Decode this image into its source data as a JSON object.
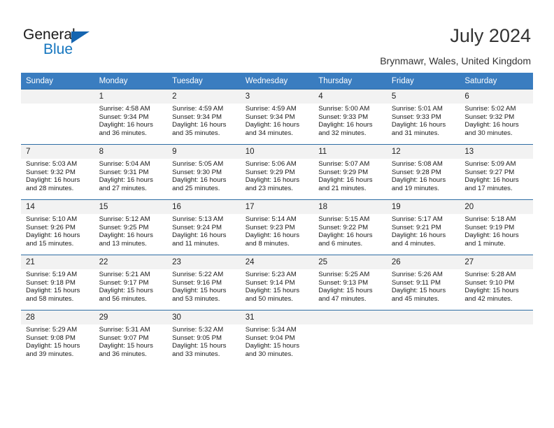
{
  "brand": {
    "name_top": "General",
    "name_bottom": "Blue",
    "accent_color": "#1576bf",
    "triangle_color": "#1565b0"
  },
  "header": {
    "title": "July 2024",
    "subtitle": "Brynmawr, Wales, United Kingdom"
  },
  "calendar": {
    "header_color": "#3a7dc0",
    "weekdays": [
      "Sunday",
      "Monday",
      "Tuesday",
      "Wednesday",
      "Thursday",
      "Friday",
      "Saturday"
    ],
    "weeks": [
      [
        {
          "day": "",
          "empty": true
        },
        {
          "day": "1",
          "sunrise": "Sunrise: 4:58 AM",
          "sunset": "Sunset: 9:34 PM",
          "daylight": "Daylight: 16 hours and 36 minutes."
        },
        {
          "day": "2",
          "sunrise": "Sunrise: 4:59 AM",
          "sunset": "Sunset: 9:34 PM",
          "daylight": "Daylight: 16 hours and 35 minutes."
        },
        {
          "day": "3",
          "sunrise": "Sunrise: 4:59 AM",
          "sunset": "Sunset: 9:34 PM",
          "daylight": "Daylight: 16 hours and 34 minutes."
        },
        {
          "day": "4",
          "sunrise": "Sunrise: 5:00 AM",
          "sunset": "Sunset: 9:33 PM",
          "daylight": "Daylight: 16 hours and 32 minutes."
        },
        {
          "day": "5",
          "sunrise": "Sunrise: 5:01 AM",
          "sunset": "Sunset: 9:33 PM",
          "daylight": "Daylight: 16 hours and 31 minutes."
        },
        {
          "day": "6",
          "sunrise": "Sunrise: 5:02 AM",
          "sunset": "Sunset: 9:32 PM",
          "daylight": "Daylight: 16 hours and 30 minutes."
        }
      ],
      [
        {
          "day": "7",
          "sunrise": "Sunrise: 5:03 AM",
          "sunset": "Sunset: 9:32 PM",
          "daylight": "Daylight: 16 hours and 28 minutes."
        },
        {
          "day": "8",
          "sunrise": "Sunrise: 5:04 AM",
          "sunset": "Sunset: 9:31 PM",
          "daylight": "Daylight: 16 hours and 27 minutes."
        },
        {
          "day": "9",
          "sunrise": "Sunrise: 5:05 AM",
          "sunset": "Sunset: 9:30 PM",
          "daylight": "Daylight: 16 hours and 25 minutes."
        },
        {
          "day": "10",
          "sunrise": "Sunrise: 5:06 AM",
          "sunset": "Sunset: 9:29 PM",
          "daylight": "Daylight: 16 hours and 23 minutes."
        },
        {
          "day": "11",
          "sunrise": "Sunrise: 5:07 AM",
          "sunset": "Sunset: 9:29 PM",
          "daylight": "Daylight: 16 hours and 21 minutes."
        },
        {
          "day": "12",
          "sunrise": "Sunrise: 5:08 AM",
          "sunset": "Sunset: 9:28 PM",
          "daylight": "Daylight: 16 hours and 19 minutes."
        },
        {
          "day": "13",
          "sunrise": "Sunrise: 5:09 AM",
          "sunset": "Sunset: 9:27 PM",
          "daylight": "Daylight: 16 hours and 17 minutes."
        }
      ],
      [
        {
          "day": "14",
          "sunrise": "Sunrise: 5:10 AM",
          "sunset": "Sunset: 9:26 PM",
          "daylight": "Daylight: 16 hours and 15 minutes."
        },
        {
          "day": "15",
          "sunrise": "Sunrise: 5:12 AM",
          "sunset": "Sunset: 9:25 PM",
          "daylight": "Daylight: 16 hours and 13 minutes."
        },
        {
          "day": "16",
          "sunrise": "Sunrise: 5:13 AM",
          "sunset": "Sunset: 9:24 PM",
          "daylight": "Daylight: 16 hours and 11 minutes."
        },
        {
          "day": "17",
          "sunrise": "Sunrise: 5:14 AM",
          "sunset": "Sunset: 9:23 PM",
          "daylight": "Daylight: 16 hours and 8 minutes."
        },
        {
          "day": "18",
          "sunrise": "Sunrise: 5:15 AM",
          "sunset": "Sunset: 9:22 PM",
          "daylight": "Daylight: 16 hours and 6 minutes."
        },
        {
          "day": "19",
          "sunrise": "Sunrise: 5:17 AM",
          "sunset": "Sunset: 9:21 PM",
          "daylight": "Daylight: 16 hours and 4 minutes."
        },
        {
          "day": "20",
          "sunrise": "Sunrise: 5:18 AM",
          "sunset": "Sunset: 9:19 PM",
          "daylight": "Daylight: 16 hours and 1 minute."
        }
      ],
      [
        {
          "day": "21",
          "sunrise": "Sunrise: 5:19 AM",
          "sunset": "Sunset: 9:18 PM",
          "daylight": "Daylight: 15 hours and 58 minutes."
        },
        {
          "day": "22",
          "sunrise": "Sunrise: 5:21 AM",
          "sunset": "Sunset: 9:17 PM",
          "daylight": "Daylight: 15 hours and 56 minutes."
        },
        {
          "day": "23",
          "sunrise": "Sunrise: 5:22 AM",
          "sunset": "Sunset: 9:16 PM",
          "daylight": "Daylight: 15 hours and 53 minutes."
        },
        {
          "day": "24",
          "sunrise": "Sunrise: 5:23 AM",
          "sunset": "Sunset: 9:14 PM",
          "daylight": "Daylight: 15 hours and 50 minutes."
        },
        {
          "day": "25",
          "sunrise": "Sunrise: 5:25 AM",
          "sunset": "Sunset: 9:13 PM",
          "daylight": "Daylight: 15 hours and 47 minutes."
        },
        {
          "day": "26",
          "sunrise": "Sunrise: 5:26 AM",
          "sunset": "Sunset: 9:11 PM",
          "daylight": "Daylight: 15 hours and 45 minutes."
        },
        {
          "day": "27",
          "sunrise": "Sunrise: 5:28 AM",
          "sunset": "Sunset: 9:10 PM",
          "daylight": "Daylight: 15 hours and 42 minutes."
        }
      ],
      [
        {
          "day": "28",
          "sunrise": "Sunrise: 5:29 AM",
          "sunset": "Sunset: 9:08 PM",
          "daylight": "Daylight: 15 hours and 39 minutes."
        },
        {
          "day": "29",
          "sunrise": "Sunrise: 5:31 AM",
          "sunset": "Sunset: 9:07 PM",
          "daylight": "Daylight: 15 hours and 36 minutes."
        },
        {
          "day": "30",
          "sunrise": "Sunrise: 5:32 AM",
          "sunset": "Sunset: 9:05 PM",
          "daylight": "Daylight: 15 hours and 33 minutes."
        },
        {
          "day": "31",
          "sunrise": "Sunrise: 5:34 AM",
          "sunset": "Sunset: 9:04 PM",
          "daylight": "Daylight: 15 hours and 30 minutes."
        },
        {
          "day": "",
          "empty": true
        },
        {
          "day": "",
          "empty": true
        },
        {
          "day": "",
          "empty": true
        }
      ]
    ]
  }
}
